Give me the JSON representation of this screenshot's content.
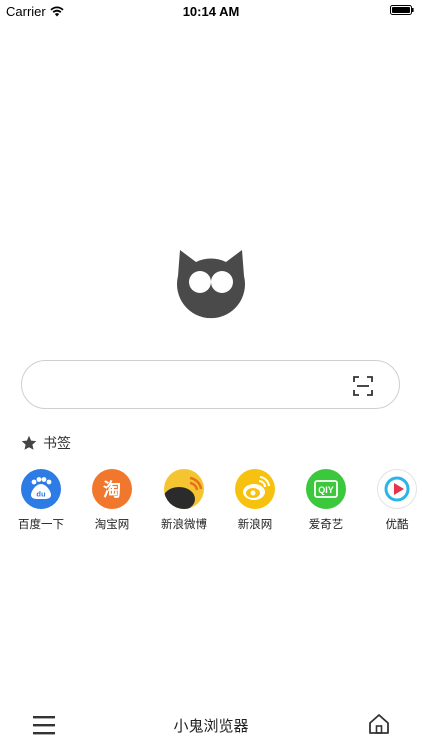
{
  "status_bar": {
    "carrier": "Carrier",
    "time": "10:14 AM"
  },
  "logo": {
    "name": "owl-logo",
    "color": "#4a4a4a"
  },
  "search": {
    "value": "",
    "placeholder": "",
    "scan_icon": "scan-icon"
  },
  "bookmarks": {
    "header_icon": "star-icon",
    "title": "书签",
    "items": [
      {
        "label": "百度一下",
        "icon_text": "du",
        "color": "#2d7be5"
      },
      {
        "label": "淘宝网",
        "icon_text": "淘",
        "color": "#f0772b"
      },
      {
        "label": "新浪微博",
        "icon_text": "",
        "color": "#f5c531"
      },
      {
        "label": "新浪网",
        "icon_text": "",
        "color": "#f7c20f"
      },
      {
        "label": "爱奇艺",
        "icon_text": "QIY",
        "color": "#3cc83c"
      },
      {
        "label": "优酷",
        "icon_text": "",
        "color": "#ffffff"
      }
    ]
  },
  "bottom_bar": {
    "menu_icon": "menu-icon",
    "title": "小鬼浏览器",
    "home_icon": "home-icon"
  }
}
